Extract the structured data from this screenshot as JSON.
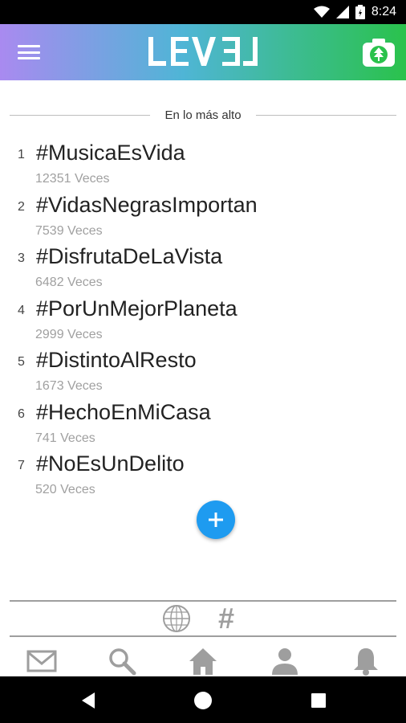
{
  "status_bar": {
    "time": "8:24"
  },
  "app_bar": {
    "logo_text": "LEVEL"
  },
  "section": {
    "title": "En lo más alto"
  },
  "trends": [
    {
      "rank": "1",
      "tag": "#MusicaEsVida",
      "count": "12351 Veces"
    },
    {
      "rank": "2",
      "tag": "#VidasNegrasImportan",
      "count": "7539 Veces"
    },
    {
      "rank": "3",
      "tag": "#DisfrutaDeLaVista",
      "count": "6482 Veces"
    },
    {
      "rank": "4",
      "tag": "#PorUnMejorPlaneta",
      "count": "2999 Veces"
    },
    {
      "rank": "5",
      "tag": "#DistintoAlResto",
      "count": "1673 Veces"
    },
    {
      "rank": "6",
      "tag": "#HechoEnMiCasa",
      "count": "741 Veces"
    },
    {
      "rank": "7",
      "tag": "#NoEsUnDelito",
      "count": "520 Veces"
    }
  ],
  "mode_toggle": {
    "hash_label": "#"
  },
  "icons": {
    "menu": "menu-icon",
    "camera": "camera-icon",
    "fab": "plus-icon",
    "globe": "globe-icon",
    "mail": "mail-icon",
    "search": "search-icon",
    "home": "home-icon",
    "profile": "person-icon",
    "notifications": "bell-icon",
    "back": "back-icon",
    "home_nav": "home-circle-icon",
    "recents": "recents-icon"
  },
  "colors": {
    "fab": "#1e9bf0",
    "gradient_start": "#a98af0",
    "gradient_end": "#2ac24c",
    "muted_icon": "#9e9e9e"
  }
}
